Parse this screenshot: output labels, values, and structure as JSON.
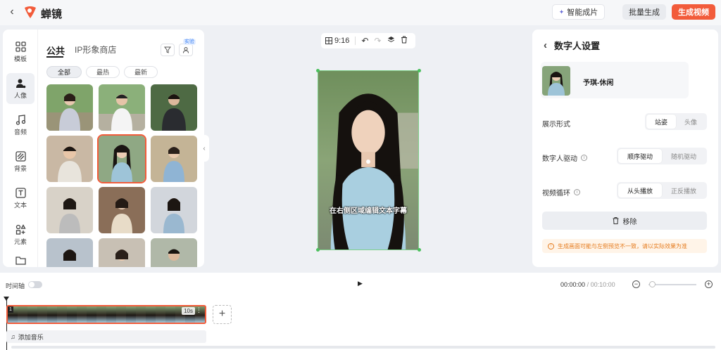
{
  "app": {
    "name": "蝉镜"
  },
  "header": {
    "smart_label": "智能成片",
    "batch_label": "批量生成",
    "generate_label": "生成视频"
  },
  "nav": {
    "items": [
      {
        "label": "模板",
        "icon": "template-icon"
      },
      {
        "label": "人像",
        "icon": "person-icon"
      },
      {
        "label": "音频",
        "icon": "music-note-icon"
      },
      {
        "label": "背景",
        "icon": "background-icon"
      },
      {
        "label": "文本",
        "icon": "text-icon"
      },
      {
        "label": "元素",
        "icon": "elements-icon"
      }
    ]
  },
  "library": {
    "tabs": [
      "公共",
      "IP形象商店"
    ],
    "beta_badge": "实验",
    "filters": [
      "全部",
      "最热",
      "最新"
    ]
  },
  "canvas": {
    "aspect_ratio": "9:16",
    "subtitle": "在右侧区域编辑文本字幕"
  },
  "settings": {
    "title": "数字人设置",
    "avatar_name": "予琪-休闲",
    "display_label": "展示形式",
    "display_options": [
      "站姿",
      "头像"
    ],
    "drive_label": "数字人驱动",
    "drive_options": [
      "顺序驱动",
      "随机驱动"
    ],
    "loop_label": "视频循环",
    "loop_options": [
      "从头播放",
      "正反播放"
    ],
    "remove_label": "移除",
    "warning": "生成画面可能与左侧预览不一致，请以实际效果为准"
  },
  "timeline": {
    "label": "时间轴",
    "current_time": "00:00:00",
    "separator": "/",
    "total_time": "00:10:00",
    "clip_number": "1",
    "clip_duration": "10s",
    "add_music": "添加音乐"
  },
  "colors": {
    "accent": "#f25b3a",
    "selection": "#7fd08a"
  }
}
